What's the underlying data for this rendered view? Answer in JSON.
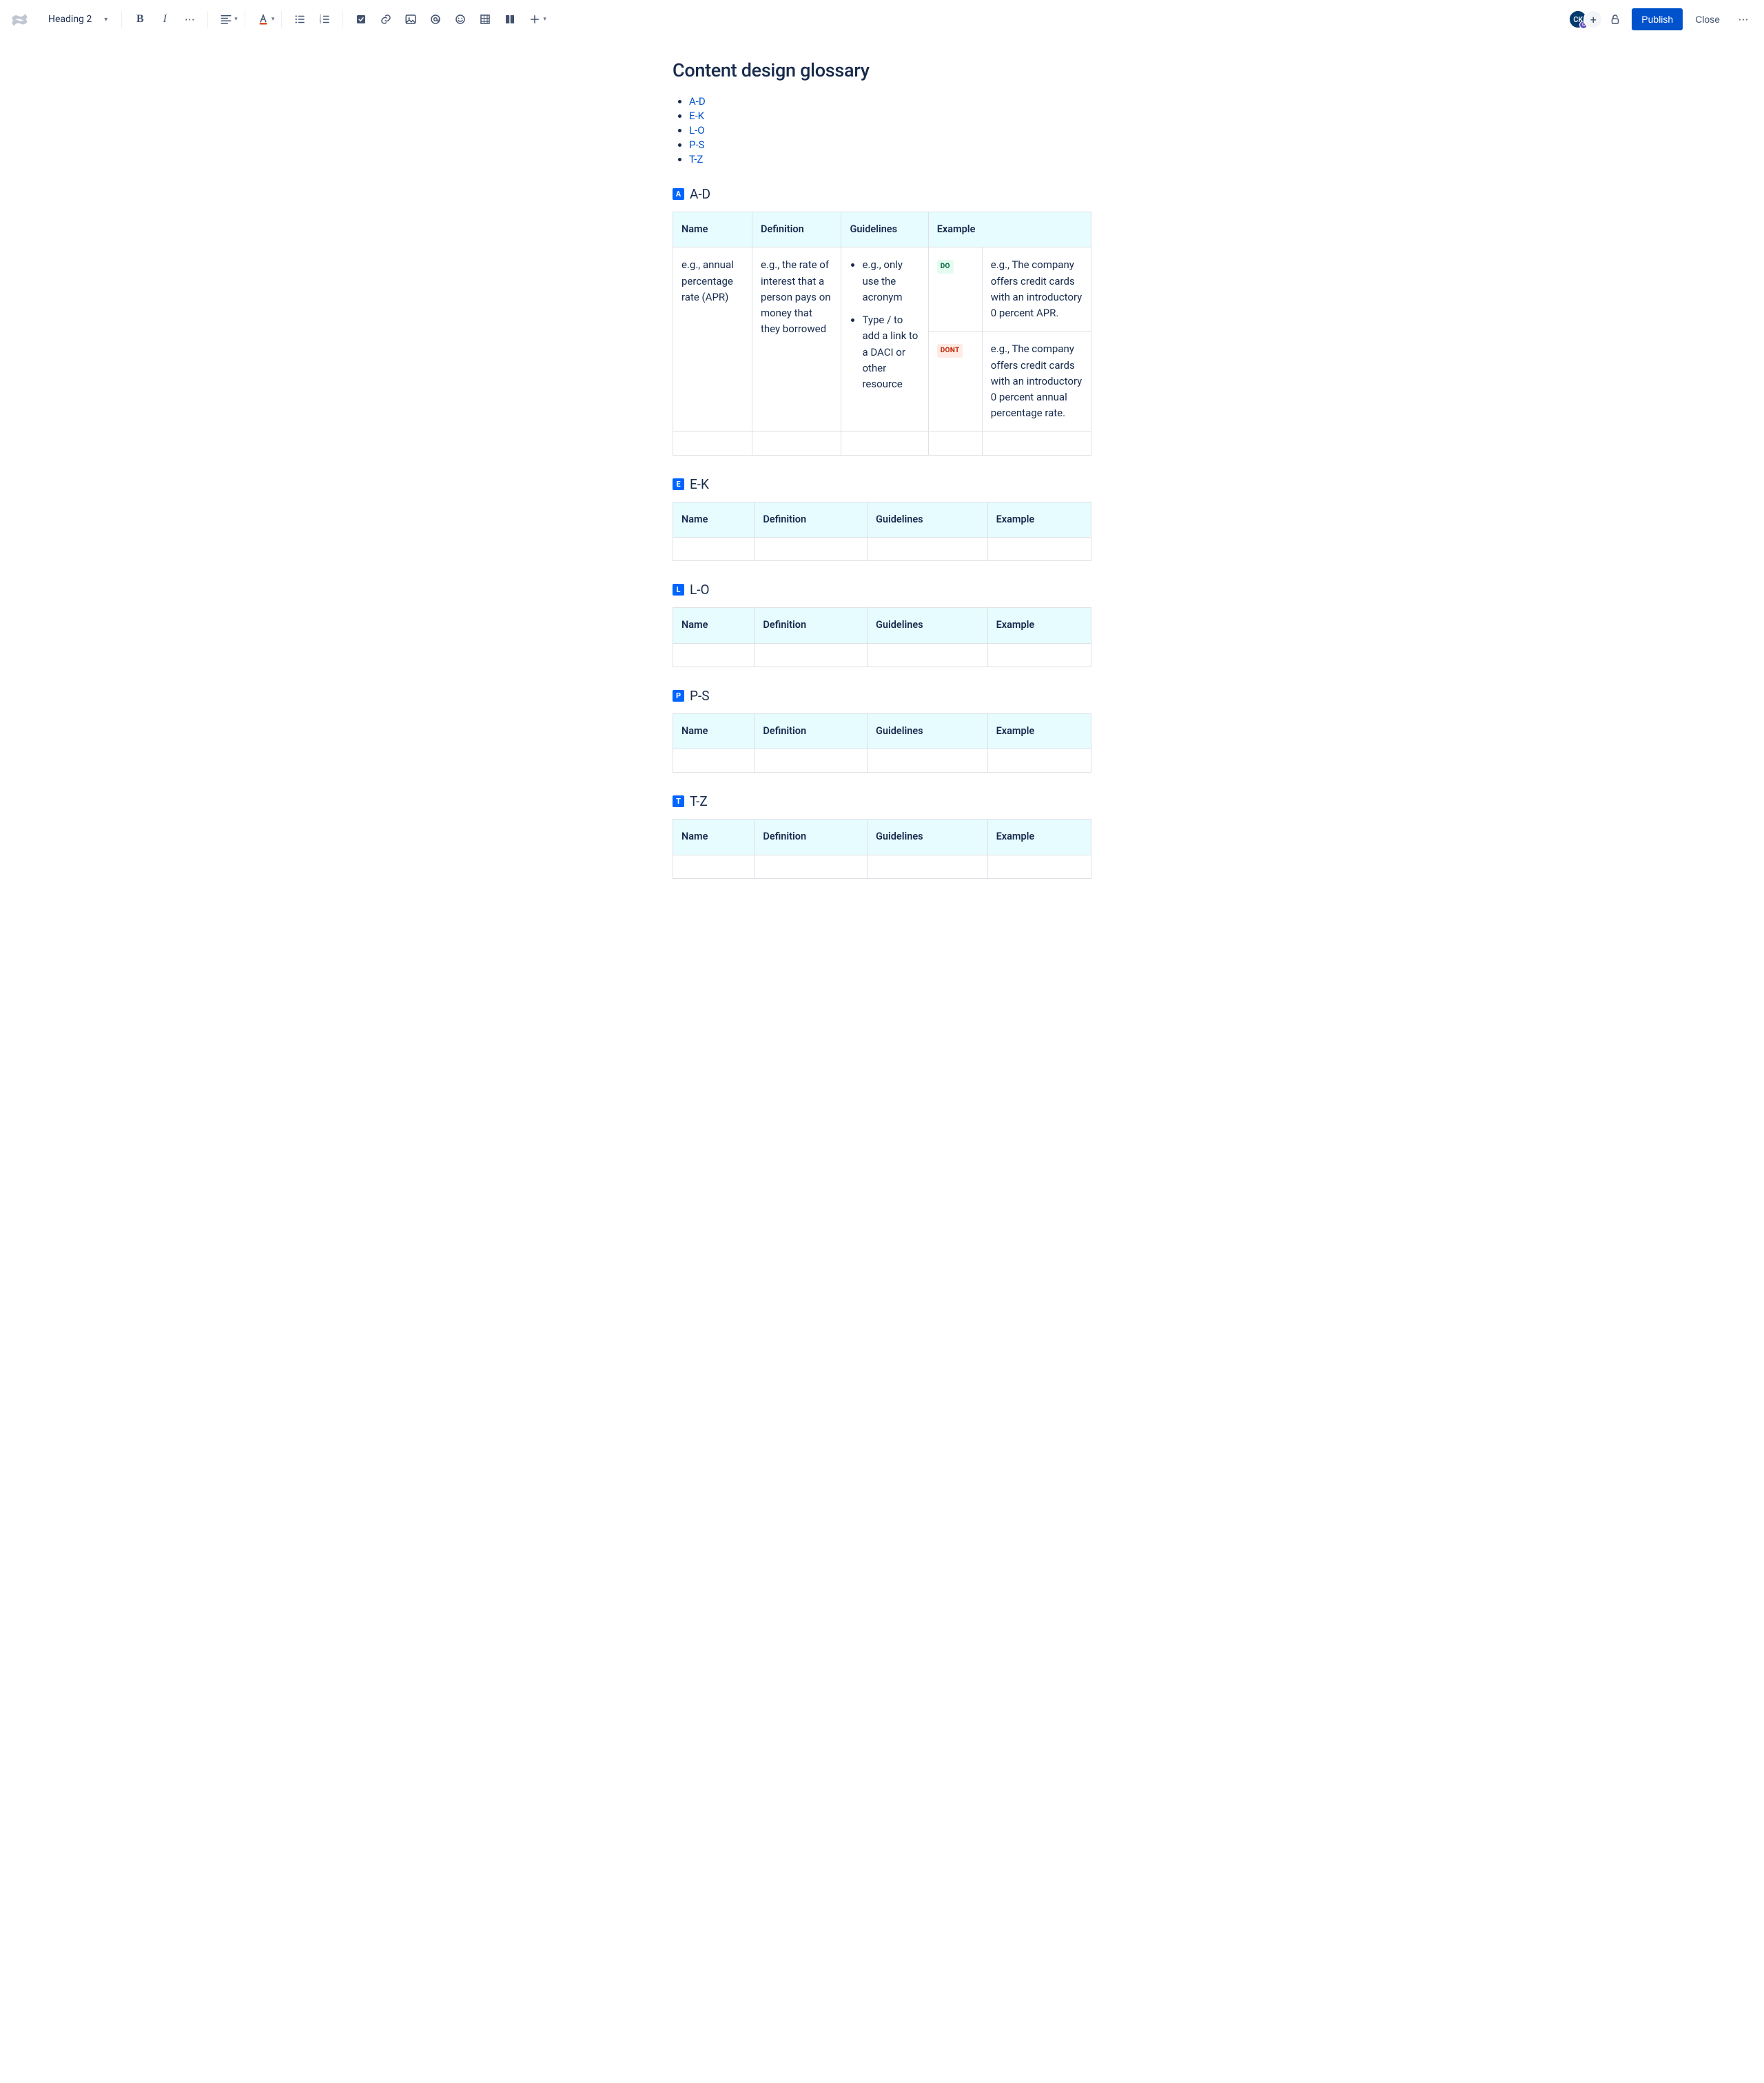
{
  "toolbar": {
    "styleSelect": "Heading 2",
    "publishLabel": "Publish",
    "closeLabel": "Close",
    "avatarInitials": "CK",
    "avatarSub": "C"
  },
  "page": {
    "title": "Content design glossary",
    "toc": [
      "A-D",
      "E-K",
      "L-O",
      "P-S",
      "T-Z"
    ]
  },
  "tableHeaders": [
    "Name",
    "Definition",
    "Guidelines",
    "Example"
  ],
  "sections": [
    {
      "badge": "A",
      "label": "A-D"
    },
    {
      "badge": "E",
      "label": "E-K"
    },
    {
      "badge": "L",
      "label": "L-O"
    },
    {
      "badge": "P",
      "label": "P-S"
    },
    {
      "badge": "T",
      "label": "T-Z"
    }
  ],
  "firstTable": {
    "name": "e.g., annual percentage rate (APR)",
    "definition": "e.g., the rate of interest that a person pays on money that they borrowed",
    "guidelines": [
      "e.g., only use the acronym",
      "Type / to add a link to a DACI or other resource"
    ],
    "doLabel": "DO",
    "doExample": "e.g., The company offers credit cards with an introductory 0 percent APR.",
    "dontLabel": "DONT",
    "dontExample": "e.g., The company offers credit cards with an introductory 0 percent annual percentage rate."
  }
}
